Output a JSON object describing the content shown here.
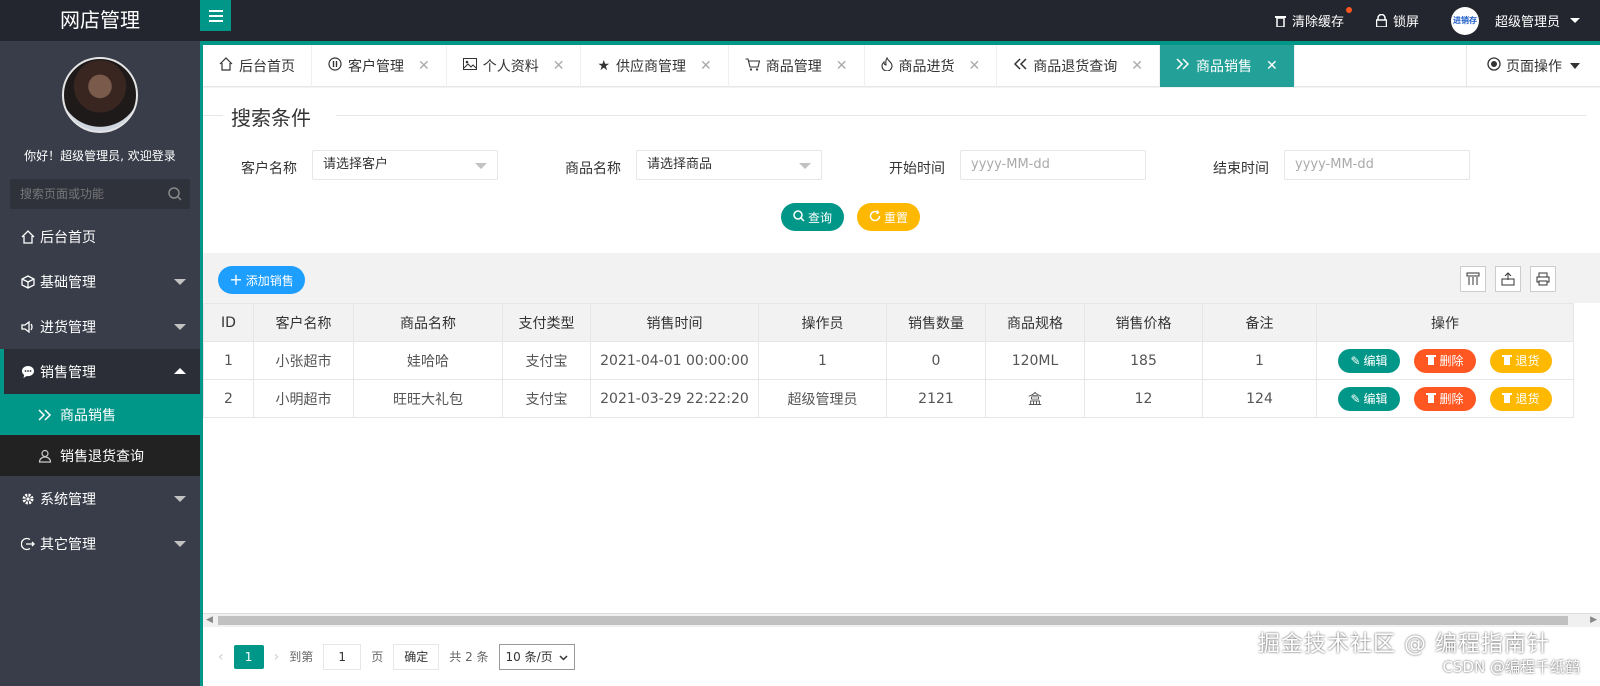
{
  "app": {
    "title": "网店管理"
  },
  "topbar": {
    "clear_cache": "清除缓存",
    "lock_screen": "锁屏",
    "user_name": "超级管理员",
    "avatar_text": "进销存"
  },
  "sidebar": {
    "welcome": "你好！超级管理员, 欢迎登录",
    "search_placeholder": "搜索页面或功能",
    "items": [
      {
        "label": "后台首页",
        "icon": "home-icon"
      },
      {
        "label": "基础管理",
        "icon": "cube-icon"
      },
      {
        "label": "进货管理",
        "icon": "speaker-icon"
      },
      {
        "label": "销售管理",
        "icon": "chat-icon"
      },
      {
        "label": "商品销售",
        "icon": "double-chevron-icon"
      },
      {
        "label": "销售退货查询",
        "icon": "user-icon"
      },
      {
        "label": "系统管理",
        "icon": "gear-icon"
      },
      {
        "label": "其它管理",
        "icon": "exit-icon"
      }
    ]
  },
  "tabs": [
    {
      "label": "后台首页"
    },
    {
      "label": "客户管理"
    },
    {
      "label": "个人资料"
    },
    {
      "label": "供应商管理"
    },
    {
      "label": "商品管理"
    },
    {
      "label": "商品进货"
    },
    {
      "label": "商品退货查询"
    },
    {
      "label": "商品销售"
    }
  ],
  "page_ops": "页面操作",
  "search": {
    "title": "搜索条件",
    "customer_label": "客户名称",
    "customer_value": "请选择客户",
    "product_label": "商品名称",
    "product_value": "请选择商品",
    "start_label": "开始时间",
    "start_placeholder": "yyyy-MM-dd",
    "end_label": "结束时间",
    "end_placeholder": "yyyy-MM-dd",
    "query_btn": "查询",
    "reset_btn": "重置"
  },
  "toolbar": {
    "add_btn": "添加销售"
  },
  "table": {
    "headers": [
      "ID",
      "客户名称",
      "商品名称",
      "支付类型",
      "销售时间",
      "操作员",
      "销售数量",
      "商品规格",
      "销售价格",
      "备注",
      "操作"
    ],
    "rows": [
      [
        "1",
        "小张超市",
        "娃哈哈",
        "支付宝",
        "2021-04-01 00:00:00",
        "1",
        "0",
        "120ML",
        "185",
        "1"
      ],
      [
        "2",
        "小明超市",
        "旺旺大礼包",
        "支付宝",
        "2021-03-29 22:22:20",
        "超级管理员",
        "2121",
        "盒",
        "12",
        "124"
      ]
    ],
    "edit": "编辑",
    "delete": "删除",
    "return": "退货"
  },
  "pager": {
    "current": "1",
    "goto": "到第",
    "page_input": "1",
    "page_unit": "页",
    "confirm": "确定",
    "total": "共 2 条",
    "page_size": "10 条/页"
  },
  "watermark": {
    "line1": "掘金技术社区 @ 编程指南针",
    "line2": "CSDN @编程千纸鹤"
  },
  "colors": {
    "teal": "#009688",
    "orange": "#ff5722",
    "yellow": "#ffb800",
    "blue": "#1e9fff",
    "sidebar": "#393d49",
    "topbar": "#23262e"
  }
}
